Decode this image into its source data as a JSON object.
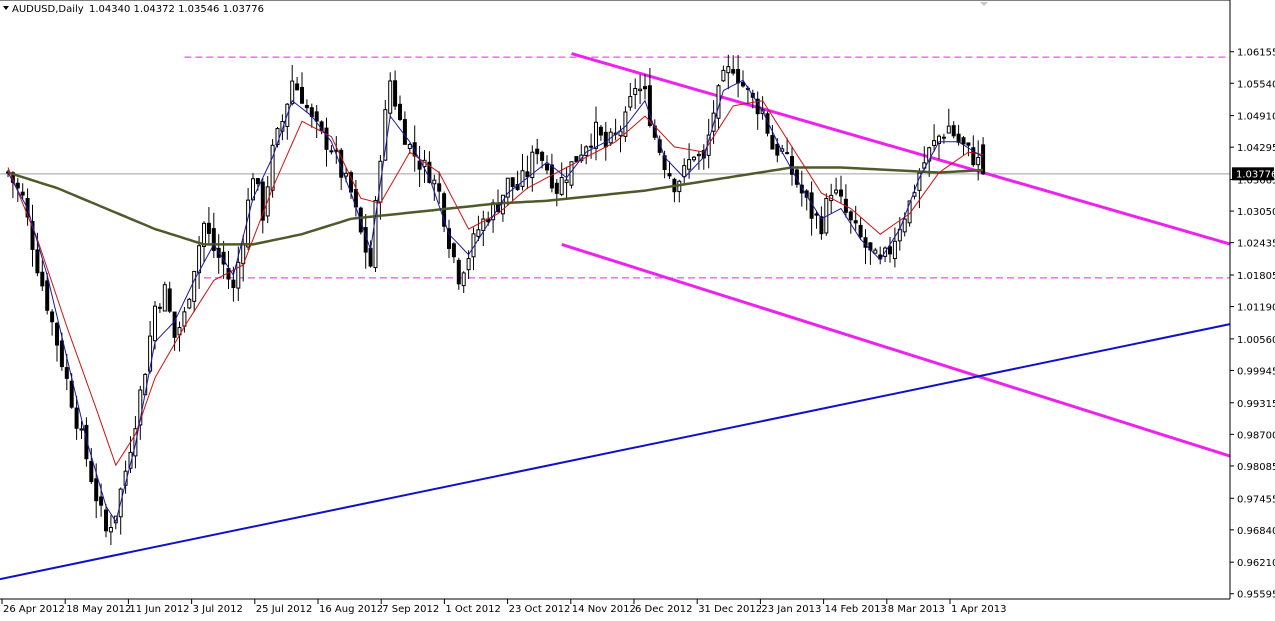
{
  "header": {
    "symbol": "AUDUSD,Daily",
    "ohlc": "1.04340 1.04372 1.03546 1.03776"
  },
  "price_label": "1.03776",
  "colors": {
    "candle": "#000000",
    "ma_fast": "#1a1aa0",
    "ma_mid": "#d01010",
    "ma_slow": "#4d5a2a",
    "channel": "#ee22ee",
    "trend": "#1010c8",
    "price_line": "#a0a0a0"
  },
  "chart_data": {
    "type": "candlestick",
    "ylim": [
      0.9559,
      1.065
    ],
    "y_ticks": [
      "1.06155",
      "1.05540",
      "1.04910",
      "1.04295",
      "1.03665",
      "1.03050",
      "1.02435",
      "1.01805",
      "1.01190",
      "1.00560",
      "0.99945",
      "0.99315",
      "0.98700",
      "0.98085",
      "0.97455",
      "0.96840",
      "0.96210",
      "0.95595"
    ],
    "x_labels": [
      "26 Apr 2012",
      "18 May 2012",
      "11 Jun 2012",
      "3 Jul 2012",
      "25 Jul 2012",
      "16 Aug 2012",
      "7 Sep 2012",
      "1 Oct 2012",
      "23 Oct 2012",
      "14 Nov 2012",
      "6 Dec 2012",
      "31 Dec 2012",
      "23 Jan 2013",
      "14 Feb 2013",
      "8 Mar 2013",
      "1 Apr 2013"
    ],
    "last_close": 1.03776,
    "close_path": [
      [
        0,
        1.038
      ],
      [
        3,
        1.033
      ],
      [
        6,
        1.02
      ],
      [
        10,
        1.005
      ],
      [
        14,
        0.99
      ],
      [
        18,
        0.975
      ],
      [
        20,
        0.968
      ],
      [
        22,
        0.972
      ],
      [
        24,
        0.98
      ],
      [
        26,
        0.99
      ],
      [
        28,
        1.0
      ],
      [
        30,
        1.012
      ],
      [
        32,
        1.015
      ],
      [
        34,
        1.006
      ],
      [
        36,
        1.01
      ],
      [
        38,
        1.02
      ],
      [
        40,
        1.028
      ],
      [
        42,
        1.023
      ],
      [
        44,
        1.02
      ],
      [
        46,
        1.015
      ],
      [
        48,
        1.026
      ],
      [
        50,
        1.038
      ],
      [
        52,
        1.03
      ],
      [
        54,
        1.042
      ],
      [
        56,
        1.048
      ],
      [
        58,
        1.056
      ],
      [
        60,
        1.053
      ],
      [
        62,
        1.048
      ],
      [
        64,
        1.045
      ],
      [
        66,
        1.043
      ],
      [
        68,
        1.038
      ],
      [
        70,
        1.034
      ],
      [
        72,
        1.026
      ],
      [
        74,
        1.02
      ],
      [
        76,
        1.042
      ],
      [
        78,
        1.056
      ],
      [
        80,
        1.048
      ],
      [
        82,
        1.043
      ],
      [
        84,
        1.04
      ],
      [
        86,
        1.038
      ],
      [
        88,
        1.034
      ],
      [
        90,
        1.025
      ],
      [
        92,
        1.018
      ],
      [
        94,
        1.022
      ],
      [
        96,
        1.027
      ],
      [
        98,
        1.03
      ],
      [
        100,
        1.032
      ],
      [
        102,
        1.036
      ],
      [
        104,
        1.035
      ],
      [
        106,
        1.038
      ],
      [
        108,
        1.043
      ],
      [
        110,
        1.039
      ],
      [
        112,
        1.035
      ],
      [
        114,
        1.038
      ],
      [
        116,
        1.041
      ],
      [
        118,
        1.044
      ],
      [
        120,
        1.046
      ],
      [
        122,
        1.043
      ],
      [
        124,
        1.045
      ],
      [
        126,
        1.048
      ],
      [
        128,
        1.055
      ],
      [
        130,
        1.053
      ],
      [
        132,
        1.045
      ],
      [
        134,
        1.04
      ],
      [
        136,
        1.036
      ],
      [
        138,
        1.038
      ],
      [
        140,
        1.042
      ],
      [
        142,
        1.04
      ],
      [
        144,
        1.05
      ],
      [
        146,
        1.056
      ],
      [
        148,
        1.059
      ],
      [
        150,
        1.055
      ],
      [
        152,
        1.052
      ],
      [
        154,
        1.05
      ],
      [
        156,
        1.043
      ],
      [
        158,
        1.042
      ],
      [
        160,
        1.038
      ],
      [
        162,
        1.034
      ],
      [
        164,
        1.03
      ],
      [
        166,
        1.028
      ],
      [
        168,
        1.035
      ],
      [
        170,
        1.032
      ],
      [
        172,
        1.028
      ],
      [
        174,
        1.025
      ],
      [
        176,
        1.022
      ],
      [
        178,
        1.02
      ],
      [
        180,
        1.023
      ],
      [
        182,
        1.028
      ],
      [
        184,
        1.032
      ],
      [
        186,
        1.038
      ],
      [
        188,
        1.042
      ],
      [
        190,
        1.045
      ],
      [
        192,
        1.047
      ],
      [
        194,
        1.044
      ],
      [
        196,
        1.042
      ],
      [
        198,
        1.04
      ],
      [
        199,
        1.03776
      ]
    ],
    "ma_fast_path": [
      [
        0,
        1.038
      ],
      [
        4,
        1.031
      ],
      [
        8,
        1.018
      ],
      [
        12,
        1.002
      ],
      [
        16,
        0.986
      ],
      [
        20,
        0.973
      ],
      [
        22,
        0.97
      ],
      [
        26,
        0.985
      ],
      [
        30,
        1.005
      ],
      [
        34,
        1.009
      ],
      [
        38,
        1.017
      ],
      [
        42,
        1.024
      ],
      [
        46,
        1.018
      ],
      [
        50,
        1.033
      ],
      [
        54,
        1.041
      ],
      [
        58,
        1.052
      ],
      [
        62,
        1.049
      ],
      [
        66,
        1.044
      ],
      [
        70,
        1.034
      ],
      [
        74,
        1.023
      ],
      [
        78,
        1.049
      ],
      [
        82,
        1.044
      ],
      [
        86,
        1.037
      ],
      [
        90,
        1.026
      ],
      [
        94,
        1.022
      ],
      [
        98,
        1.028
      ],
      [
        102,
        1.034
      ],
      [
        106,
        1.037
      ],
      [
        110,
        1.04
      ],
      [
        114,
        1.037
      ],
      [
        118,
        1.042
      ],
      [
        122,
        1.044
      ],
      [
        126,
        1.047
      ],
      [
        130,
        1.052
      ],
      [
        134,
        1.041
      ],
      [
        138,
        1.037
      ],
      [
        142,
        1.041
      ],
      [
        146,
        1.054
      ],
      [
        150,
        1.056
      ],
      [
        154,
        1.05
      ],
      [
        158,
        1.042
      ],
      [
        162,
        1.035
      ],
      [
        166,
        1.029
      ],
      [
        170,
        1.031
      ],
      [
        174,
        1.025
      ],
      [
        178,
        1.021
      ],
      [
        182,
        1.027
      ],
      [
        186,
        1.037
      ],
      [
        190,
        1.044
      ],
      [
        194,
        1.044
      ],
      [
        199,
        1.041
      ]
    ],
    "ma_mid_path": [
      [
        0,
        1.039
      ],
      [
        6,
        1.025
      ],
      [
        12,
        1.008
      ],
      [
        18,
        0.992
      ],
      [
        22,
        0.981
      ],
      [
        26,
        0.987
      ],
      [
        30,
        0.998
      ],
      [
        36,
        1.008
      ],
      [
        42,
        1.017
      ],
      [
        48,
        1.02
      ],
      [
        54,
        1.035
      ],
      [
        60,
        1.048
      ],
      [
        66,
        1.045
      ],
      [
        72,
        1.033
      ],
      [
        76,
        1.032
      ],
      [
        82,
        1.042
      ],
      [
        88,
        1.038
      ],
      [
        94,
        1.027
      ],
      [
        100,
        1.03
      ],
      [
        106,
        1.035
      ],
      [
        112,
        1.038
      ],
      [
        118,
        1.041
      ],
      [
        124,
        1.044
      ],
      [
        130,
        1.049
      ],
      [
        136,
        1.043
      ],
      [
        142,
        1.042
      ],
      [
        148,
        1.051
      ],
      [
        154,
        1.052
      ],
      [
        160,
        1.043
      ],
      [
        166,
        1.034
      ],
      [
        172,
        1.031
      ],
      [
        178,
        1.026
      ],
      [
        184,
        1.03
      ],
      [
        190,
        1.038
      ],
      [
        196,
        1.042
      ],
      [
        199,
        1.0415
      ]
    ],
    "ma_slow_path": [
      [
        0,
        1.038
      ],
      [
        10,
        1.035
      ],
      [
        20,
        1.031
      ],
      [
        30,
        1.027
      ],
      [
        40,
        1.024
      ],
      [
        50,
        1.024
      ],
      [
        60,
        1.026
      ],
      [
        70,
        1.029
      ],
      [
        80,
        1.03
      ],
      [
        90,
        1.031
      ],
      [
        100,
        1.032
      ],
      [
        110,
        1.0325
      ],
      [
        120,
        1.0335
      ],
      [
        130,
        1.0345
      ],
      [
        140,
        1.036
      ],
      [
        150,
        1.0375
      ],
      [
        160,
        1.039
      ],
      [
        170,
        1.039
      ],
      [
        180,
        1.0385
      ],
      [
        190,
        1.038
      ],
      [
        199,
        1.0385
      ]
    ],
    "hlines": [
      {
        "level": 1.0605,
        "from": 36,
        "to": 199
      },
      {
        "level": 1.0175,
        "from": 40,
        "to": 199
      }
    ],
    "channel_lines": [
      {
        "from": [
          115,
          1.0612
        ],
        "to": [
          199,
          1.038
        ]
      },
      {
        "from": [
          113,
          1.024
        ],
        "to": [
          199,
          0.998
        ]
      }
    ],
    "trend_line": {
      "from": [
        0,
        0.9588
      ],
      "to": [
        199,
        0.9985
      ]
    }
  }
}
